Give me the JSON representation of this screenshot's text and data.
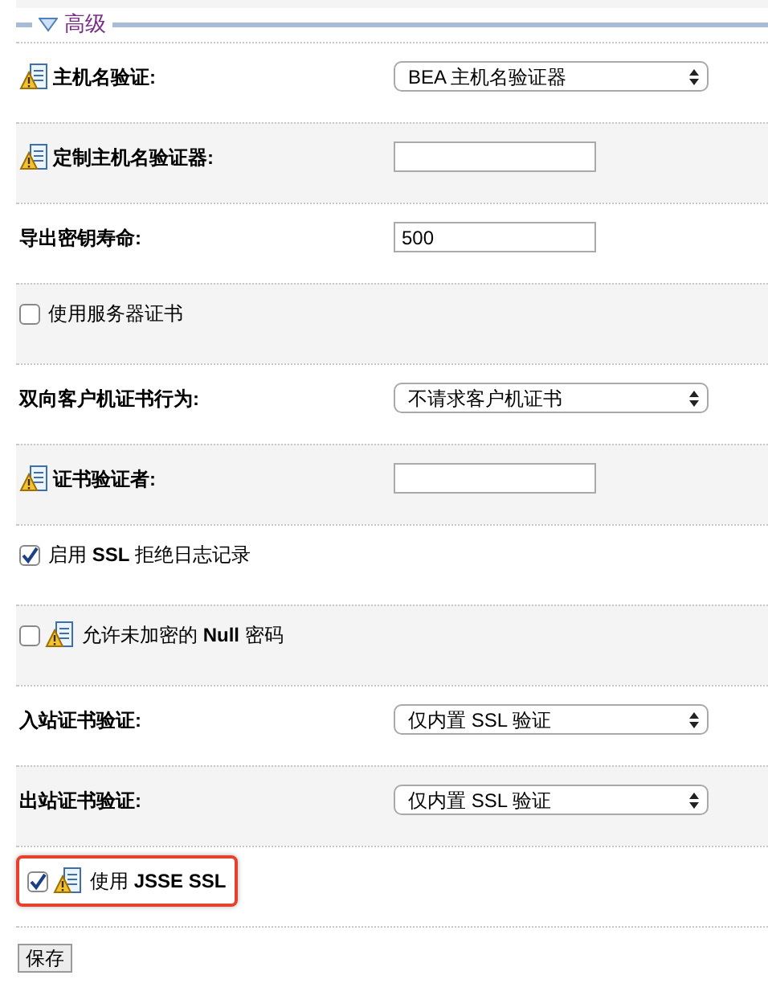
{
  "section": {
    "title": "高级",
    "expanded": true
  },
  "rows": [
    {
      "kind": "select",
      "label": "主机名验证:",
      "warning": true,
      "value": "BEA 主机名验证器"
    },
    {
      "kind": "input",
      "label": "定制主机名验证器:",
      "warning": true
    },
    {
      "kind": "input",
      "label": "导出密钥寿命:",
      "warning": false,
      "value": "500"
    },
    {
      "kind": "checkbox",
      "label": "使用服务器证书",
      "warning": false,
      "checked": false,
      "highlighted": false
    },
    {
      "kind": "select",
      "label": "双向客户机证书行为:",
      "warning": false,
      "value": "不请求客户机证书"
    },
    {
      "kind": "input",
      "label": "证书验证者:",
      "warning": true
    },
    {
      "kind": "checkbox",
      "label": "启用 **SSL** 拒绝日志记录",
      "warning": false,
      "checked": true,
      "highlighted": false
    },
    {
      "kind": "checkbox",
      "label": "允许未加密的 **Null** 密码",
      "warning": true,
      "checked": false,
      "highlighted": false
    },
    {
      "kind": "select",
      "label": "入站证书验证:",
      "warning": false,
      "value": "仅内置 SSL 验证"
    },
    {
      "kind": "select",
      "label": "出站证书验证:",
      "warning": false,
      "value": "仅内置 SSL 验证"
    },
    {
      "kind": "checkbox",
      "label": "使用 **JSSE SSL**",
      "warning": true,
      "checked": true,
      "highlighted": true
    }
  ],
  "save_button": "保存"
}
